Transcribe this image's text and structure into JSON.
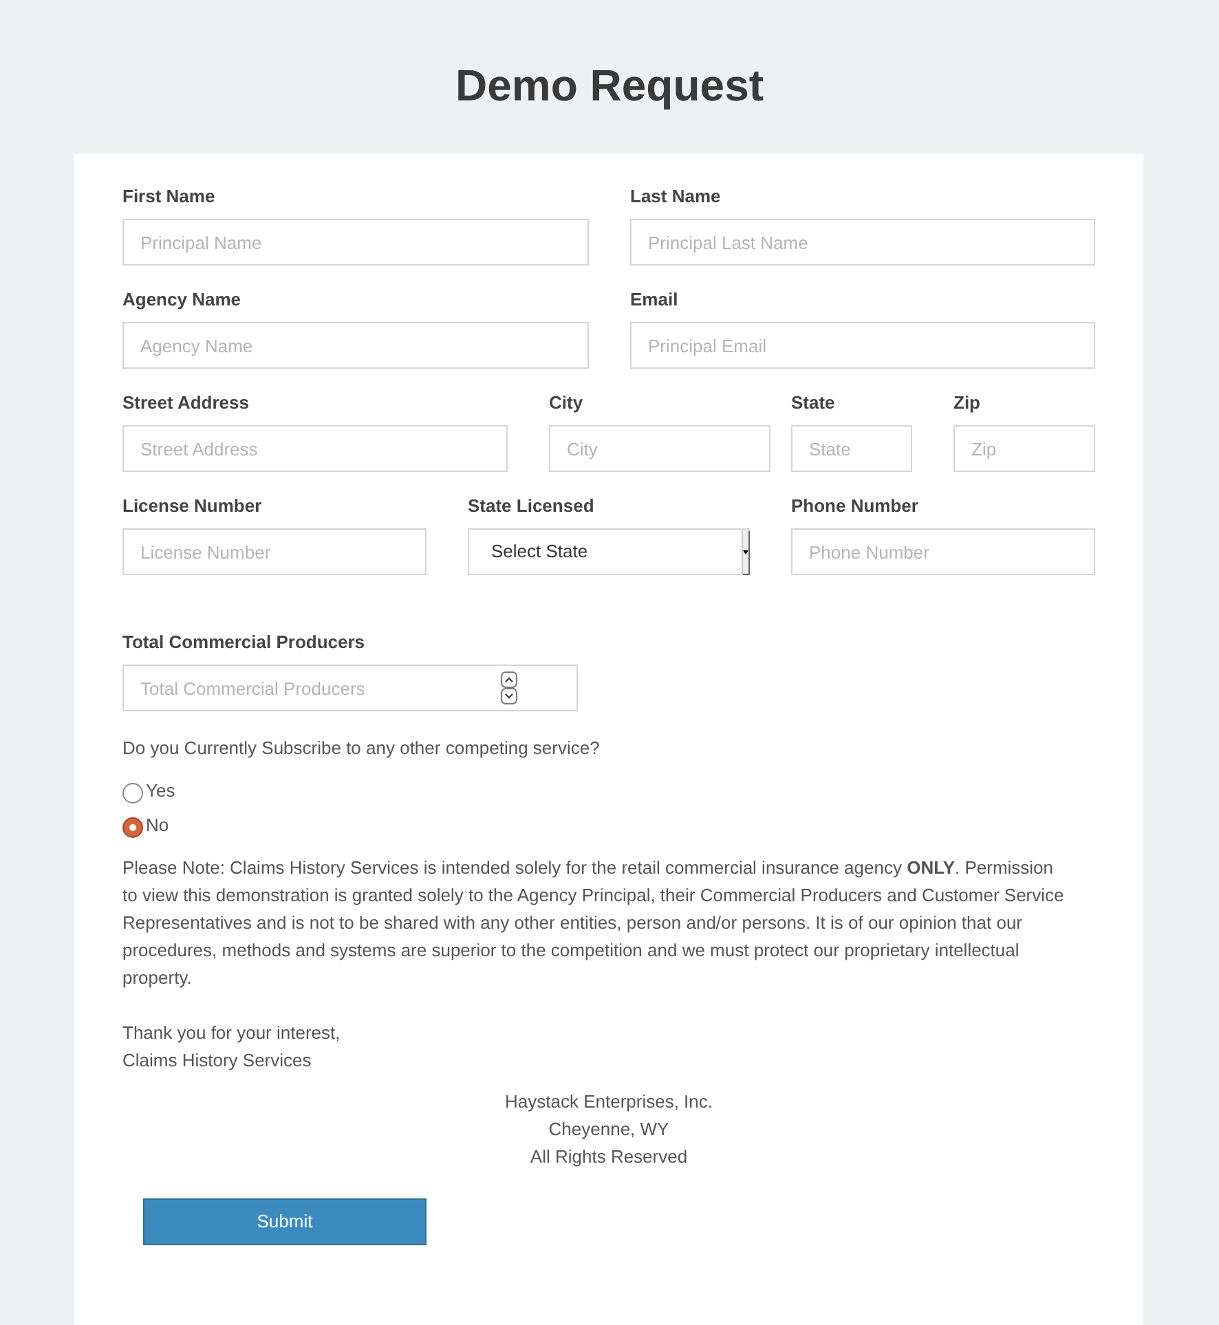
{
  "title": "Demo Request",
  "field_rows": [
    [
      {
        "label": "First Name",
        "kind": "text",
        "placeholder": "Principal Name"
      },
      {
        "label": "Last Name",
        "kind": "text",
        "placeholder": "Principal Last Name"
      }
    ],
    [
      {
        "label": "Agency Name",
        "kind": "text",
        "placeholder": "Agency Name"
      },
      {
        "label": "Email",
        "kind": "text",
        "placeholder": "Principal Email"
      }
    ],
    [
      {
        "label": "Street Address",
        "kind": "text",
        "placeholder": "Street Address"
      },
      {
        "label": "City",
        "kind": "text",
        "placeholder": "City"
      },
      {
        "label": "State",
        "kind": "text",
        "placeholder": "State"
      },
      {
        "label": "Zip",
        "kind": "text",
        "placeholder": "Zip"
      }
    ],
    [
      {
        "label": "License Number",
        "kind": "text",
        "placeholder": "License Number"
      },
      {
        "label": "State Licensed",
        "kind": "select",
        "value": "Select State"
      },
      {
        "label": "Phone Number",
        "kind": "text",
        "placeholder": "Phone Number"
      }
    ],
    [
      {
        "label": "Total Commercial Producers",
        "kind": "number",
        "placeholder": "Total Commercial Producers"
      }
    ]
  ],
  "question": {
    "label": "Do you Currently Subscribe to any other competing service?",
    "options": [
      {
        "label": "Yes",
        "selected": false
      },
      {
        "label": "No",
        "selected": true
      }
    ]
  },
  "notice": "Please Note: Claims History Services is intended solely for the retail commercial insurance agency **ONLY**. Permission to view this demonstration is granted solely to the Agency Principal, their Commercial Producers and Customer Service Representatives and is not to be shared with any other entities, person and/or persons. It is of our opinion that our procedures, methods and systems are superior to the competition and we must protect our proprietary intellectual property.",
  "closing": [
    "Thank you for your interest,",
    "Claims History Services"
  ],
  "footer": [
    "Haystack Enterprises, Inc.",
    "Cheyenne, WY",
    "All Rights Reserved"
  ],
  "submit": "Submit"
}
